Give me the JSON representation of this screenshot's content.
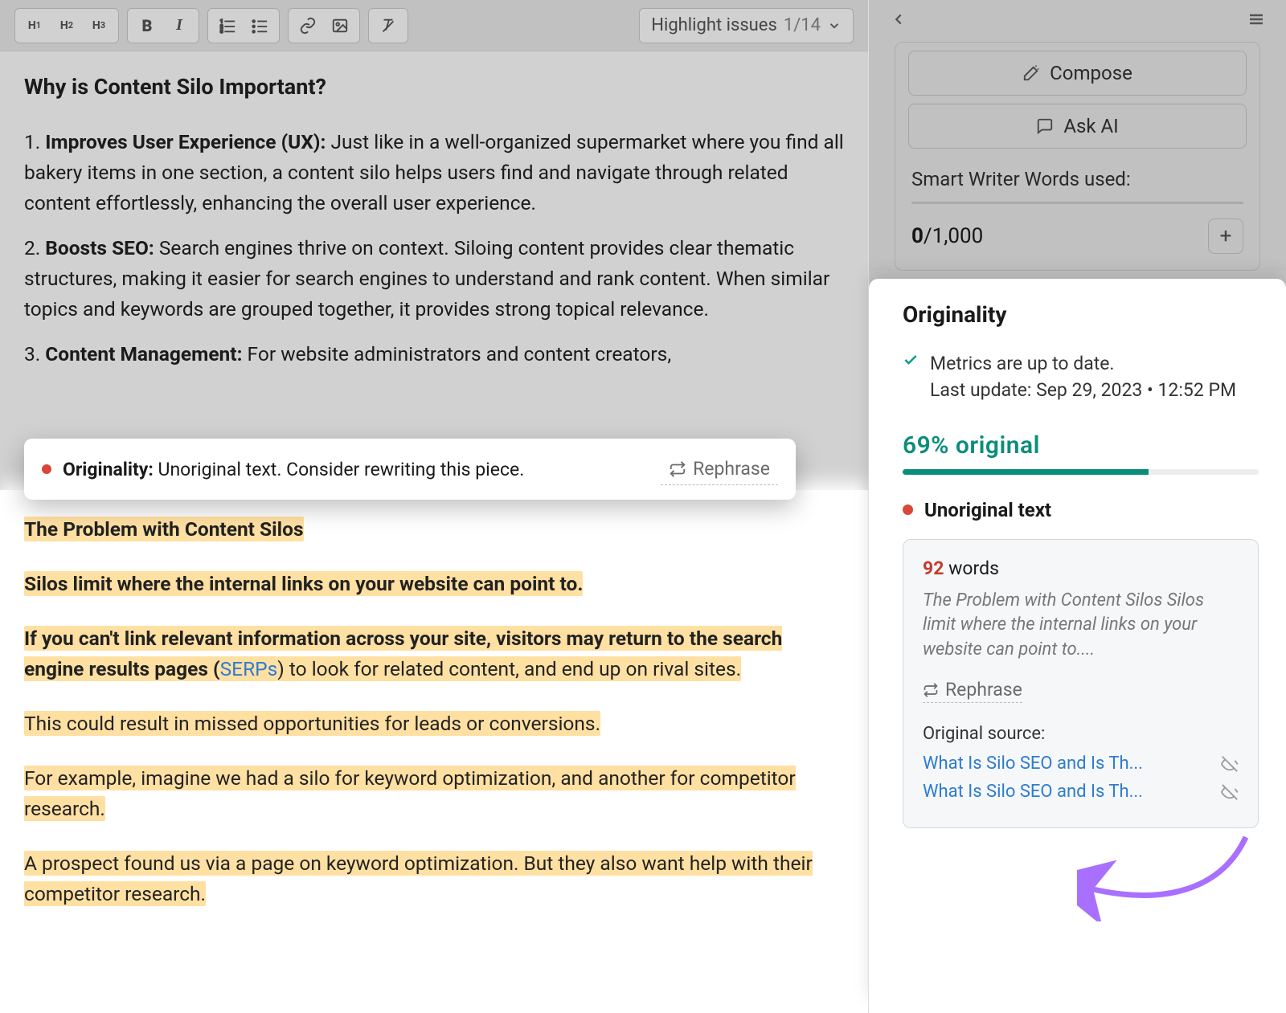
{
  "toolbar": {
    "highlight_label": "Highlight issues",
    "highlight_count": "1/14"
  },
  "editor": {
    "heading": "Why is Content Silo Important?",
    "items": [
      {
        "num": "1.",
        "title": "Improves User Experience (UX):",
        "body": " Just like in a well-organized supermarket where you find all bakery items in one section, a content silo helps users find and navigate through related content effortlessly, enhancing the overall user experience."
      },
      {
        "num": "2.",
        "title": "Boosts SEO:",
        "body": " Search engines thrive on context. Siloing content provides clear thematic structures, making it easier for search engines to understand and rank content. When similar topics and keywords are grouped together, it provides strong topical relevance."
      },
      {
        "num": "3.",
        "title": "Content Management:",
        "body": " For website administrators and content creators,"
      }
    ],
    "hl_heading": "The Problem with Content Silos",
    "hl_p1": "Silos limit where the internal links on your website can point to.",
    "hl_p2a": "If you can't link relevant information across your site, visitors may return to the search engine results pages (",
    "hl_p2_link": "SERPs",
    "hl_p2b": ") to look for related content, and end up on rival sites.",
    "hl_p3": "This could result in missed opportunities for leads or conversions.",
    "hl_p4": "For example, imagine we had a silo for keyword optimization, and another for competitor research.",
    "hl_p5": "A prospect found us via a page on keyword optimization. But they also want help with their competitor research."
  },
  "inline_popup": {
    "label": "Originality:",
    "msg": "Unoriginal text. Consider rewriting this piece.",
    "action": "Rephrase"
  },
  "sidebar": {
    "compose": "Compose",
    "ask_ai": "Ask AI",
    "sw_label": "Smart Writer Words used:",
    "sw_used": "0",
    "sw_total": "/1,000"
  },
  "originality": {
    "title": "Originality",
    "metrics_line1": "Metrics are up to date.",
    "metrics_line2": "Last update: Sep 29, 2023 • 12:52 PM",
    "percent": "69% original",
    "unoriginal_label": "Unoriginal text",
    "word_count": "92",
    "word_label": "words",
    "snippet": "The Problem with Content Silos Silos limit where the internal links on your website can point to....",
    "rephrase": "Rephrase",
    "source_label": "Original source:",
    "sources": [
      "What Is Silo SEO and Is Th...",
      "What Is Silo SEO and Is Th..."
    ]
  }
}
